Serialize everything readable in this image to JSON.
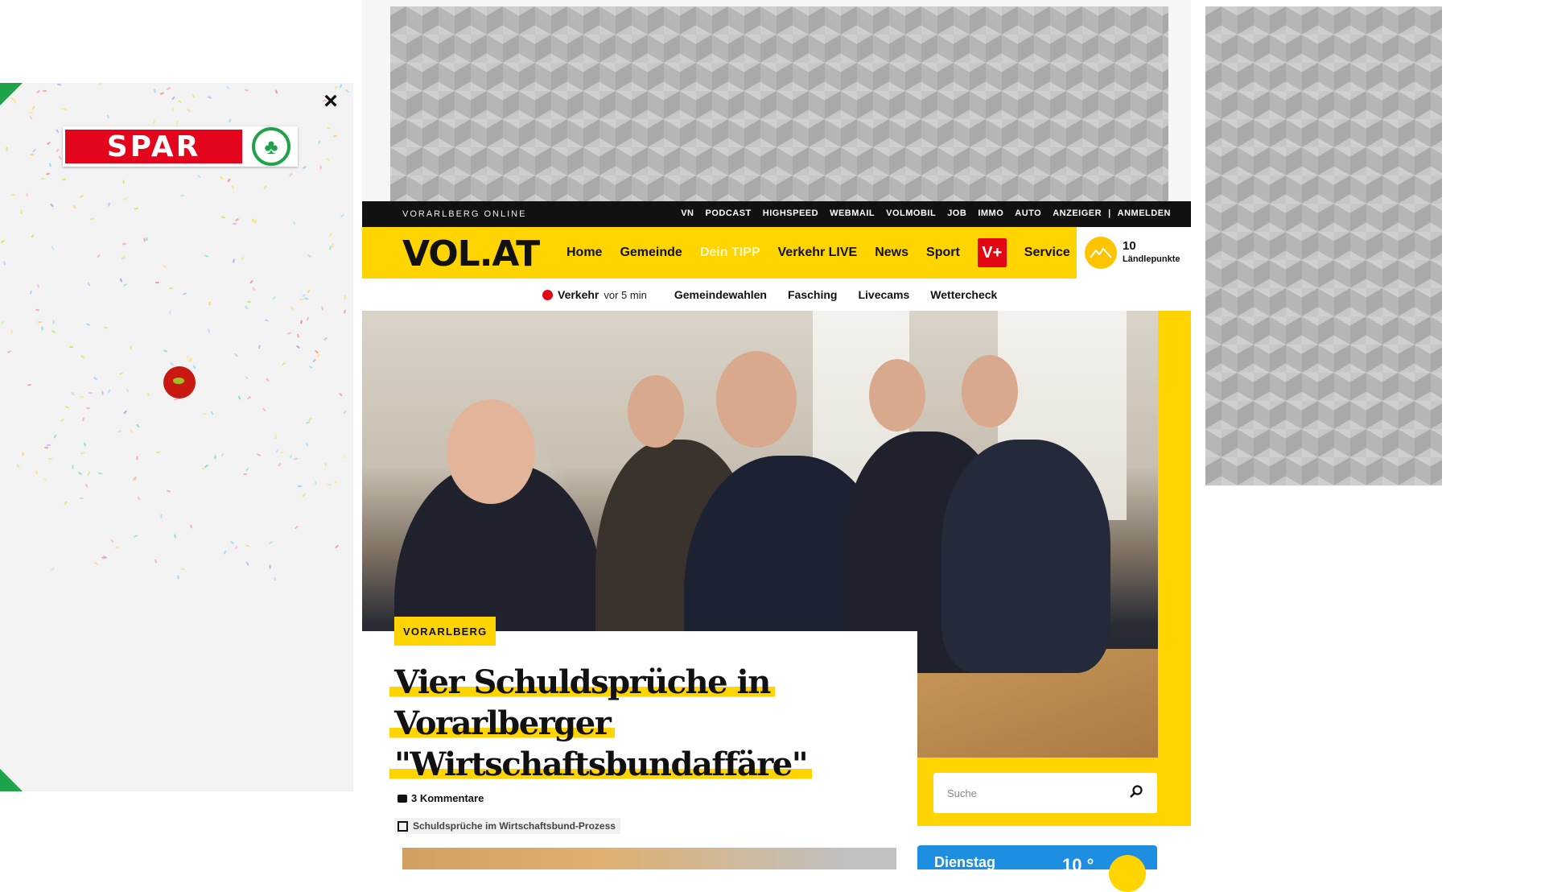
{
  "spar": {
    "brand": "SPAR",
    "close": "×",
    "colors": {
      "red": "#e3051b",
      "green": "#1ea34a"
    }
  },
  "topbar": {
    "brand": "VORARLBERG ONLINE",
    "links": [
      "VN",
      "PODCAST",
      "HIGHSPEED",
      "WEBMAIL",
      "VOLMOBIL",
      "JOB",
      "IMMO",
      "AUTO",
      "ANZEIGER"
    ],
    "separator": "|",
    "login": "ANMELDEN"
  },
  "nav": {
    "logo": "VOL.AT",
    "items": [
      "Home",
      "Gemeinde",
      "Dein TIPP",
      "Verkehr LIVE",
      "News",
      "Sport"
    ],
    "vplus": "V+",
    "service": "Service",
    "points_value": "10",
    "points_label": "Ländlepunkte",
    "colors": {
      "accent": "#ffd400",
      "vplus": "#e30613"
    }
  },
  "subnav": {
    "live_label": "Verkehr",
    "live_time": "vor 5 min",
    "links": [
      "Gemeindewahlen",
      "Fasching",
      "Livecams",
      "Wettercheck"
    ]
  },
  "article": {
    "category": "VORARLBERG",
    "headline_lines": [
      "Vier Schuldsprüche in",
      "Vorarlberger",
      "\"Wirtschaftsbundaffäre\""
    ],
    "comments": "3 Kommentare",
    "related": "Schuldsprüche im Wirtschaftsbund-Prozess"
  },
  "search": {
    "placeholder": "Suche"
  },
  "weather": {
    "day": "Dienstag",
    "temp": "10 °"
  }
}
